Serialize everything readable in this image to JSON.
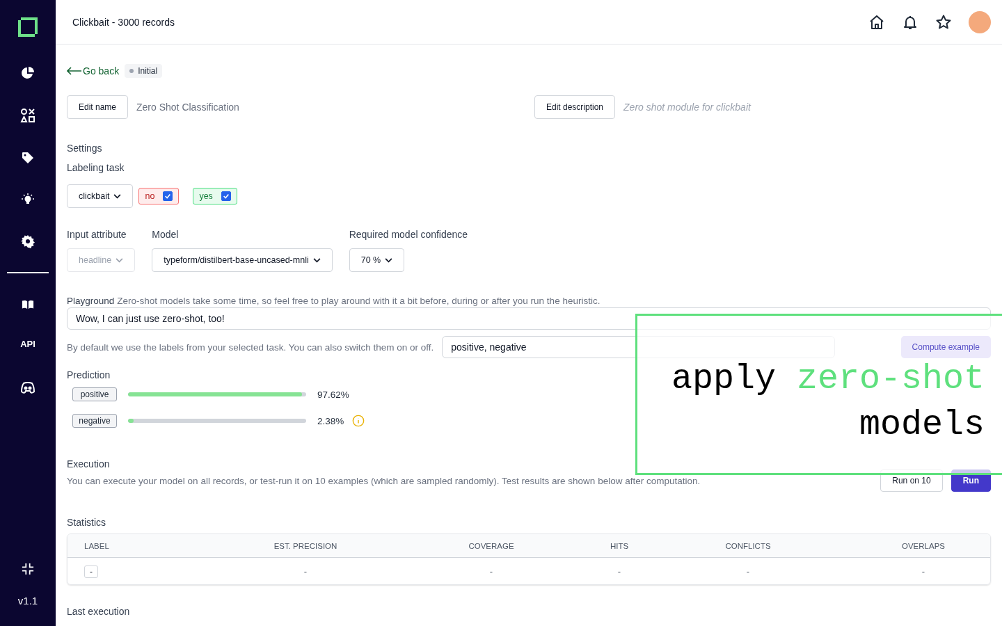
{
  "header": {
    "title": "Clickbait - 3000 records"
  },
  "sidebar": {
    "api_label": "API",
    "version": "v1.1"
  },
  "back_link": "Go back",
  "status_badge": "Initial",
  "name": {
    "button": "Edit name",
    "value": "Zero Shot Classification"
  },
  "description": {
    "button": "Edit description",
    "value": "Zero shot module for clickbait"
  },
  "settings": {
    "heading": "Settings",
    "task_label": "Labeling task",
    "task": "clickbait",
    "labels": [
      {
        "name": "no",
        "checked": true,
        "color": "#f87171"
      },
      {
        "name": "yes",
        "checked": true,
        "color": "#4ade80"
      }
    ],
    "input_attribute": {
      "label": "Input attribute",
      "value": "headline",
      "disabled": true
    },
    "model": {
      "label": "Model",
      "value": "typeform/distilbert-base-uncased-mnli"
    },
    "confidence": {
      "label": "Required model confidence",
      "value": "70 %"
    }
  },
  "playground": {
    "label": "Playground",
    "hint": "Zero-shot models take some time, so feel free to play around with it a bit before, during or after you run the heuristic.",
    "input": "Wow, I can just use zero-shot, too!",
    "labels_hint": "By default we use the labels from your selected task. You can also switch them on or off.",
    "labels_input": "positive, negative",
    "compute_button": {
      "label": "Compute example",
      "disabled": true
    }
  },
  "prediction": {
    "heading": "Prediction",
    "rows": [
      {
        "label": "positive",
        "level": 0.9762,
        "value": "97.62%",
        "warning": false
      },
      {
        "label": "negative",
        "level": 0.0238,
        "value": "2.38%",
        "warning": true
      }
    ]
  },
  "execution": {
    "heading": "Execution",
    "text": "You can execute your model on all records, or test-run it on 10 examples (which are sampled randomly). Test results are shown below after computation.",
    "buttons": [
      {
        "label": "Run on 10",
        "kind": "secondary"
      },
      {
        "label": "Run",
        "kind": "primary"
      }
    ]
  },
  "statistics": {
    "heading": "Statistics",
    "columns": [
      "LABEL",
      "EST. PRECISION",
      "COVERAGE",
      "HITS",
      "CONFLICTS",
      "OVERLAPS"
    ],
    "rows": [
      [
        "-",
        "-",
        "-",
        "-",
        "-",
        "-"
      ]
    ]
  },
  "last_execution": "Last execution",
  "overlay": {
    "lines": [
      [
        {
          "text": "apply",
          "accent": false
        },
        {
          "text": "zero-shot",
          "accent": true
        }
      ],
      [
        {
          "text": "models",
          "accent": false
        }
      ]
    ]
  }
}
